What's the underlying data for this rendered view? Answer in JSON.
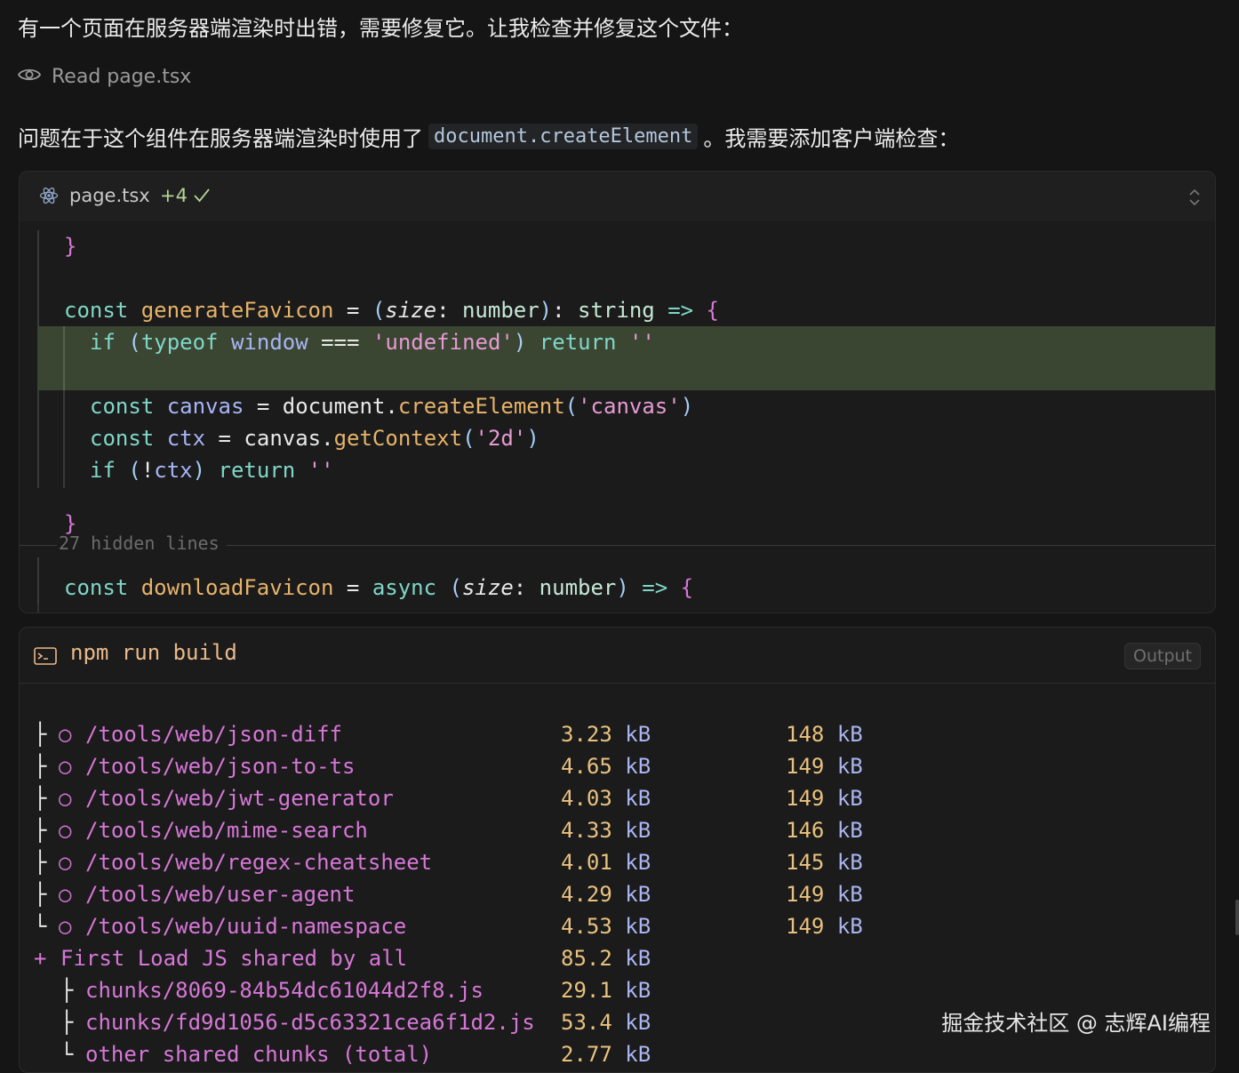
{
  "message": {
    "intro": "有一个页面在服务器端渲染时出错，需要修复它。让我检查并修复这个文件：",
    "read_action": "Read page.tsx",
    "explanation_before": "问题在于这个组件在服务器端渲染时使用了",
    "explanation_code": "document.createElement",
    "explanation_after": "。我需要添加客户端检查："
  },
  "code_panel": {
    "file_name": "page.tsx",
    "diff_count": "+4",
    "hidden_lines": "27 hidden lines"
  },
  "terminal": {
    "command": "npm run build",
    "output_button": "Output",
    "routes": [
      {
        "tree": "├",
        "marker": "○",
        "path": "/tools/web/json-diff",
        "size": "3.23",
        "first_load": "148"
      },
      {
        "tree": "├",
        "marker": "○",
        "path": "/tools/web/json-to-ts",
        "size": "4.65",
        "first_load": "149"
      },
      {
        "tree": "├",
        "marker": "○",
        "path": "/tools/web/jwt-generator",
        "size": "4.03",
        "first_load": "149"
      },
      {
        "tree": "├",
        "marker": "○",
        "path": "/tools/web/mime-search",
        "size": "4.33",
        "first_load": "146"
      },
      {
        "tree": "├",
        "marker": "○",
        "path": "/tools/web/regex-cheatsheet",
        "size": "4.01",
        "first_load": "145"
      },
      {
        "tree": "├",
        "marker": "○",
        "path": "/tools/web/user-agent",
        "size": "4.29",
        "first_load": "149"
      },
      {
        "tree": "└",
        "marker": "○",
        "path": "/tools/web/uuid-namespace",
        "size": "4.53",
        "first_load": "149"
      }
    ],
    "unit": "kB",
    "shared": {
      "plus": "+",
      "label": "First Load JS shared by all",
      "size": "85.2"
    },
    "chunks": [
      {
        "tree": "├",
        "name": "chunks/8069-84b54dc61044d2f8.js",
        "size": "29.1"
      },
      {
        "tree": "├",
        "name": "chunks/fd9d1056-d5c63321cea6f1d2.js",
        "size": "53.4"
      },
      {
        "tree": "└",
        "name": "other shared chunks (total)",
        "size": "2.77"
      }
    ]
  },
  "watermark": "掘金技术社区 @ 志辉AI编程",
  "colors": {
    "background": "#151515",
    "highlight": "#3b4632",
    "keyword": "#7fd6c8",
    "string": "#e59ad2",
    "function": "#e6b36a"
  }
}
